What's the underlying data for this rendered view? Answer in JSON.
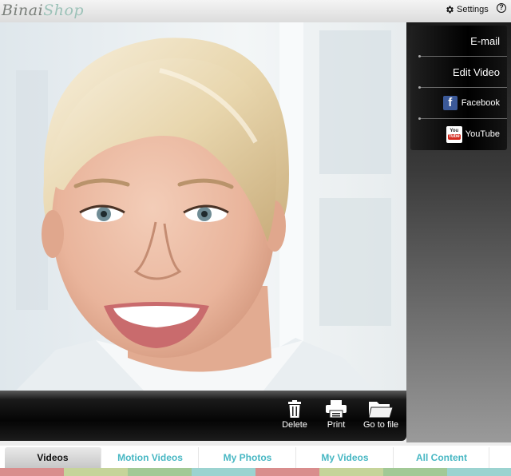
{
  "header": {
    "logo_part1": "Binai",
    "logo_part2": "Shop",
    "settings_label": "Settings",
    "help_label": "?"
  },
  "share_menu": {
    "email_label": "E-mail",
    "edit_video_label": "Edit Video",
    "facebook_label": "Facebook",
    "youtube_label": "YouTube"
  },
  "actions": {
    "delete_label": "Delete",
    "print_label": "Print",
    "goto_file_label": "Go to file"
  },
  "tabs": [
    {
      "label": "Videos",
      "active": true
    },
    {
      "label": "Motion Videos",
      "active": false
    },
    {
      "label": "My Photos",
      "active": false
    },
    {
      "label": "My Videos",
      "active": false
    },
    {
      "label": "All Content",
      "active": false
    }
  ],
  "colors": {
    "accent_teal": "#47b7c3",
    "stripe_colors": [
      "#d98d8d",
      "#c6d49a",
      "#a2c996",
      "#9bd3d0",
      "#d98d8d",
      "#c6d49a",
      "#a2c996",
      "#9bd3d0"
    ]
  },
  "icons": {
    "settings": "gear-icon",
    "help": "help-icon",
    "delete": "trash-icon",
    "print": "printer-icon",
    "goto_file": "folder-icon",
    "facebook": "facebook-icon",
    "youtube": "youtube-icon"
  }
}
